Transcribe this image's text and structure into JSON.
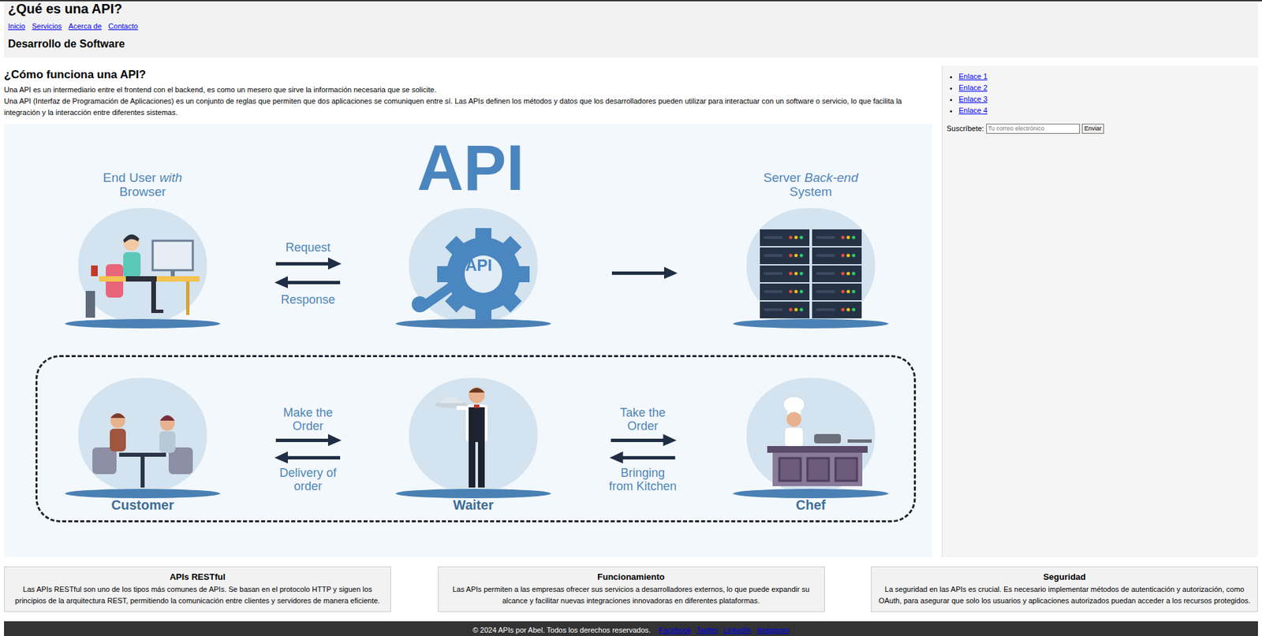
{
  "header": {
    "title": "¿Qué es una API?",
    "nav": [
      "Inicio",
      "Servicios",
      "Acerca de",
      "Contacto"
    ],
    "subtitle": "Desarrollo de Software"
  },
  "main": {
    "heading": "¿Cómo funciona una API?",
    "paragraphs": [
      "Una API es un intermediario entre el frontend con el backend, es como un mesero que sirve la información necesaria que se solicite.",
      "Una API (Interfaz de Programación de Aplicaciones) es un conjunto de reglas que permiten que dos aplicaciones se comuniquen entre sí. Las APIs definen los métodos y datos que los desarrolladores pueden utilizar para interactuar con un software o servicio, lo que facilita la integración y la interacción entre diferentes sistemas."
    ]
  },
  "diagram": {
    "title": "API",
    "gear_label": "API",
    "top_nodes": [
      {
        "kind": "user",
        "label_lines": [
          [
            {
              "text": "End User ",
              "italic": false
            },
            {
              "text": "with",
              "italic": true
            }
          ],
          [
            {
              "text": "Browser",
              "italic": false
            }
          ]
        ]
      },
      {
        "kind": "gear",
        "label_lines": []
      },
      {
        "kind": "server",
        "label_lines": [
          [
            {
              "text": "Server ",
              "italic": false
            },
            {
              "text": "Back-end",
              "italic": true
            }
          ],
          [
            {
              "text": "System",
              "italic": false
            }
          ]
        ]
      }
    ],
    "top_arrows": {
      "above": "Request",
      "below": "Response"
    },
    "bottom_nodes": [
      {
        "kind": "customer",
        "label": "Customer"
      },
      {
        "kind": "waiter",
        "label": "Waiter"
      },
      {
        "kind": "chef",
        "label": "Chef"
      }
    ],
    "bottom_arrows": [
      {
        "above": [
          "Make the",
          "Order"
        ],
        "below": [
          "Delivery of",
          "order"
        ]
      },
      {
        "above": [
          "Take the",
          "Order"
        ],
        "below": [
          "Bringing",
          "from Kitchen"
        ]
      }
    ]
  },
  "sidebar": {
    "links": [
      "Enlace 1",
      "Enlace 2",
      "Enlace 3",
      "Enlace 4"
    ],
    "subscribe": {
      "label": "Suscríbete:",
      "placeholder": "Tu correo electrónico",
      "button": "Enviar"
    }
  },
  "cards": [
    {
      "title": "APIs RESTful",
      "text": "Las APIs RESTful son uno de los tipos más comunes de APIs. Se basan en el protocolo HTTP y siguen los principios de la arquitectura REST, permitiendo la comunicación entre clientes y servidores de manera eficiente."
    },
    {
      "title": "Funcionamiento",
      "text": "Las APIs permiten a las empresas ofrecer sus servicios a desarrolladores externos, lo que puede expandir su alcance y facilitar nuevas integraciones innovadoras en diferentes plataformas."
    },
    {
      "title": "Seguridad",
      "text": "La seguridad en las APIs es crucial. Es necesario implementar métodos de autenticación y autorización, como OAuth, para asegurar que solo los usuarios y aplicaciones autorizados puedan acceder a los recursos protegidos."
    }
  ],
  "footer": {
    "copyright": "© 2024 APIs por Abel. Todos los derechos reservados.",
    "links": [
      "Facebook",
      "Twitter",
      "LinkedIn",
      "Instagram"
    ]
  }
}
